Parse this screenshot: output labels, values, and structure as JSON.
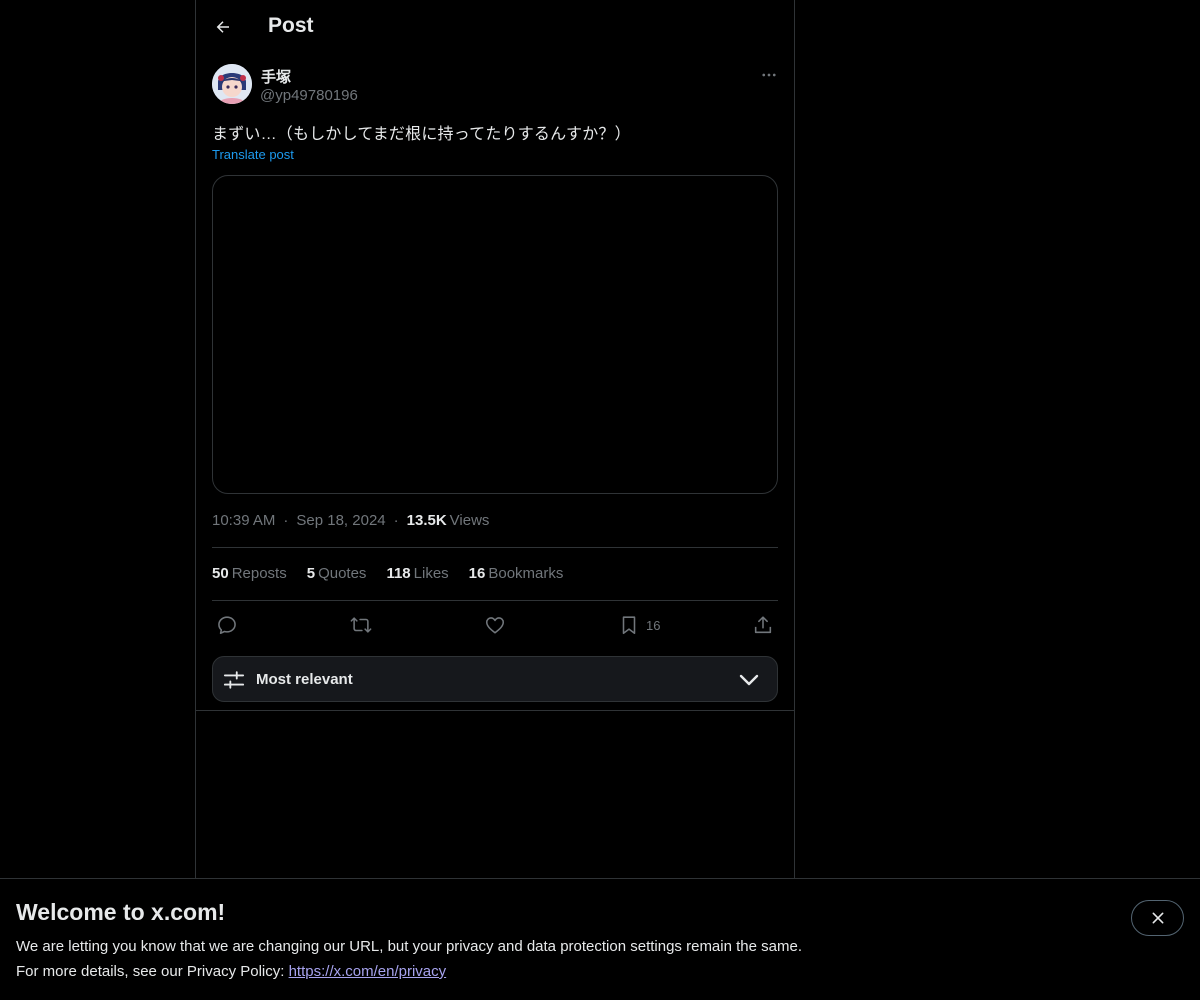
{
  "header": {
    "title": "Post",
    "back_icon": "arrow-left-icon"
  },
  "author": {
    "name": "手塚",
    "handle": "@yp49780196",
    "more_icon": "more-horizontal-icon"
  },
  "post": {
    "text": "まずい…（もしかしてまだ根に持ってたりするんすか？）",
    "translate_label": "Translate post",
    "time": "10:39 AM",
    "date": "Sep 18, 2024",
    "views_count": "13.5K",
    "views_label": "Views",
    "separator": "·"
  },
  "stats": {
    "reposts_count": "50",
    "reposts_label": "Reposts",
    "quotes_count": "5",
    "quotes_label": "Quotes",
    "likes_count": "118",
    "likes_label": "Likes",
    "bookmarks_count": "16",
    "bookmarks_label": "Bookmarks"
  },
  "actions": {
    "reply_icon": "reply-icon",
    "repost_icon": "repost-icon",
    "like_icon": "heart-icon",
    "bookmark_icon": "bookmark-icon",
    "bookmark_count": "16",
    "share_icon": "share-icon"
  },
  "sort": {
    "label": "Most relevant",
    "icon": "sliders-icon",
    "chevron": "chevron-down-icon"
  },
  "banner": {
    "title": "Welcome to x.com!",
    "line1": "We are letting you know that we are changing our URL, but your privacy and data protection settings remain the same.",
    "line2_prefix": "For more details, see our Privacy Policy: ",
    "link_text": "https://x.com/en/privacy",
    "close_icon": "close-icon"
  },
  "colors": {
    "background": "#000000",
    "text_primary": "#e7e9ea",
    "text_secondary": "#71767b",
    "link": "#1d9bf0",
    "border": "#2f3336",
    "banner_link": "#a7a3ee"
  }
}
